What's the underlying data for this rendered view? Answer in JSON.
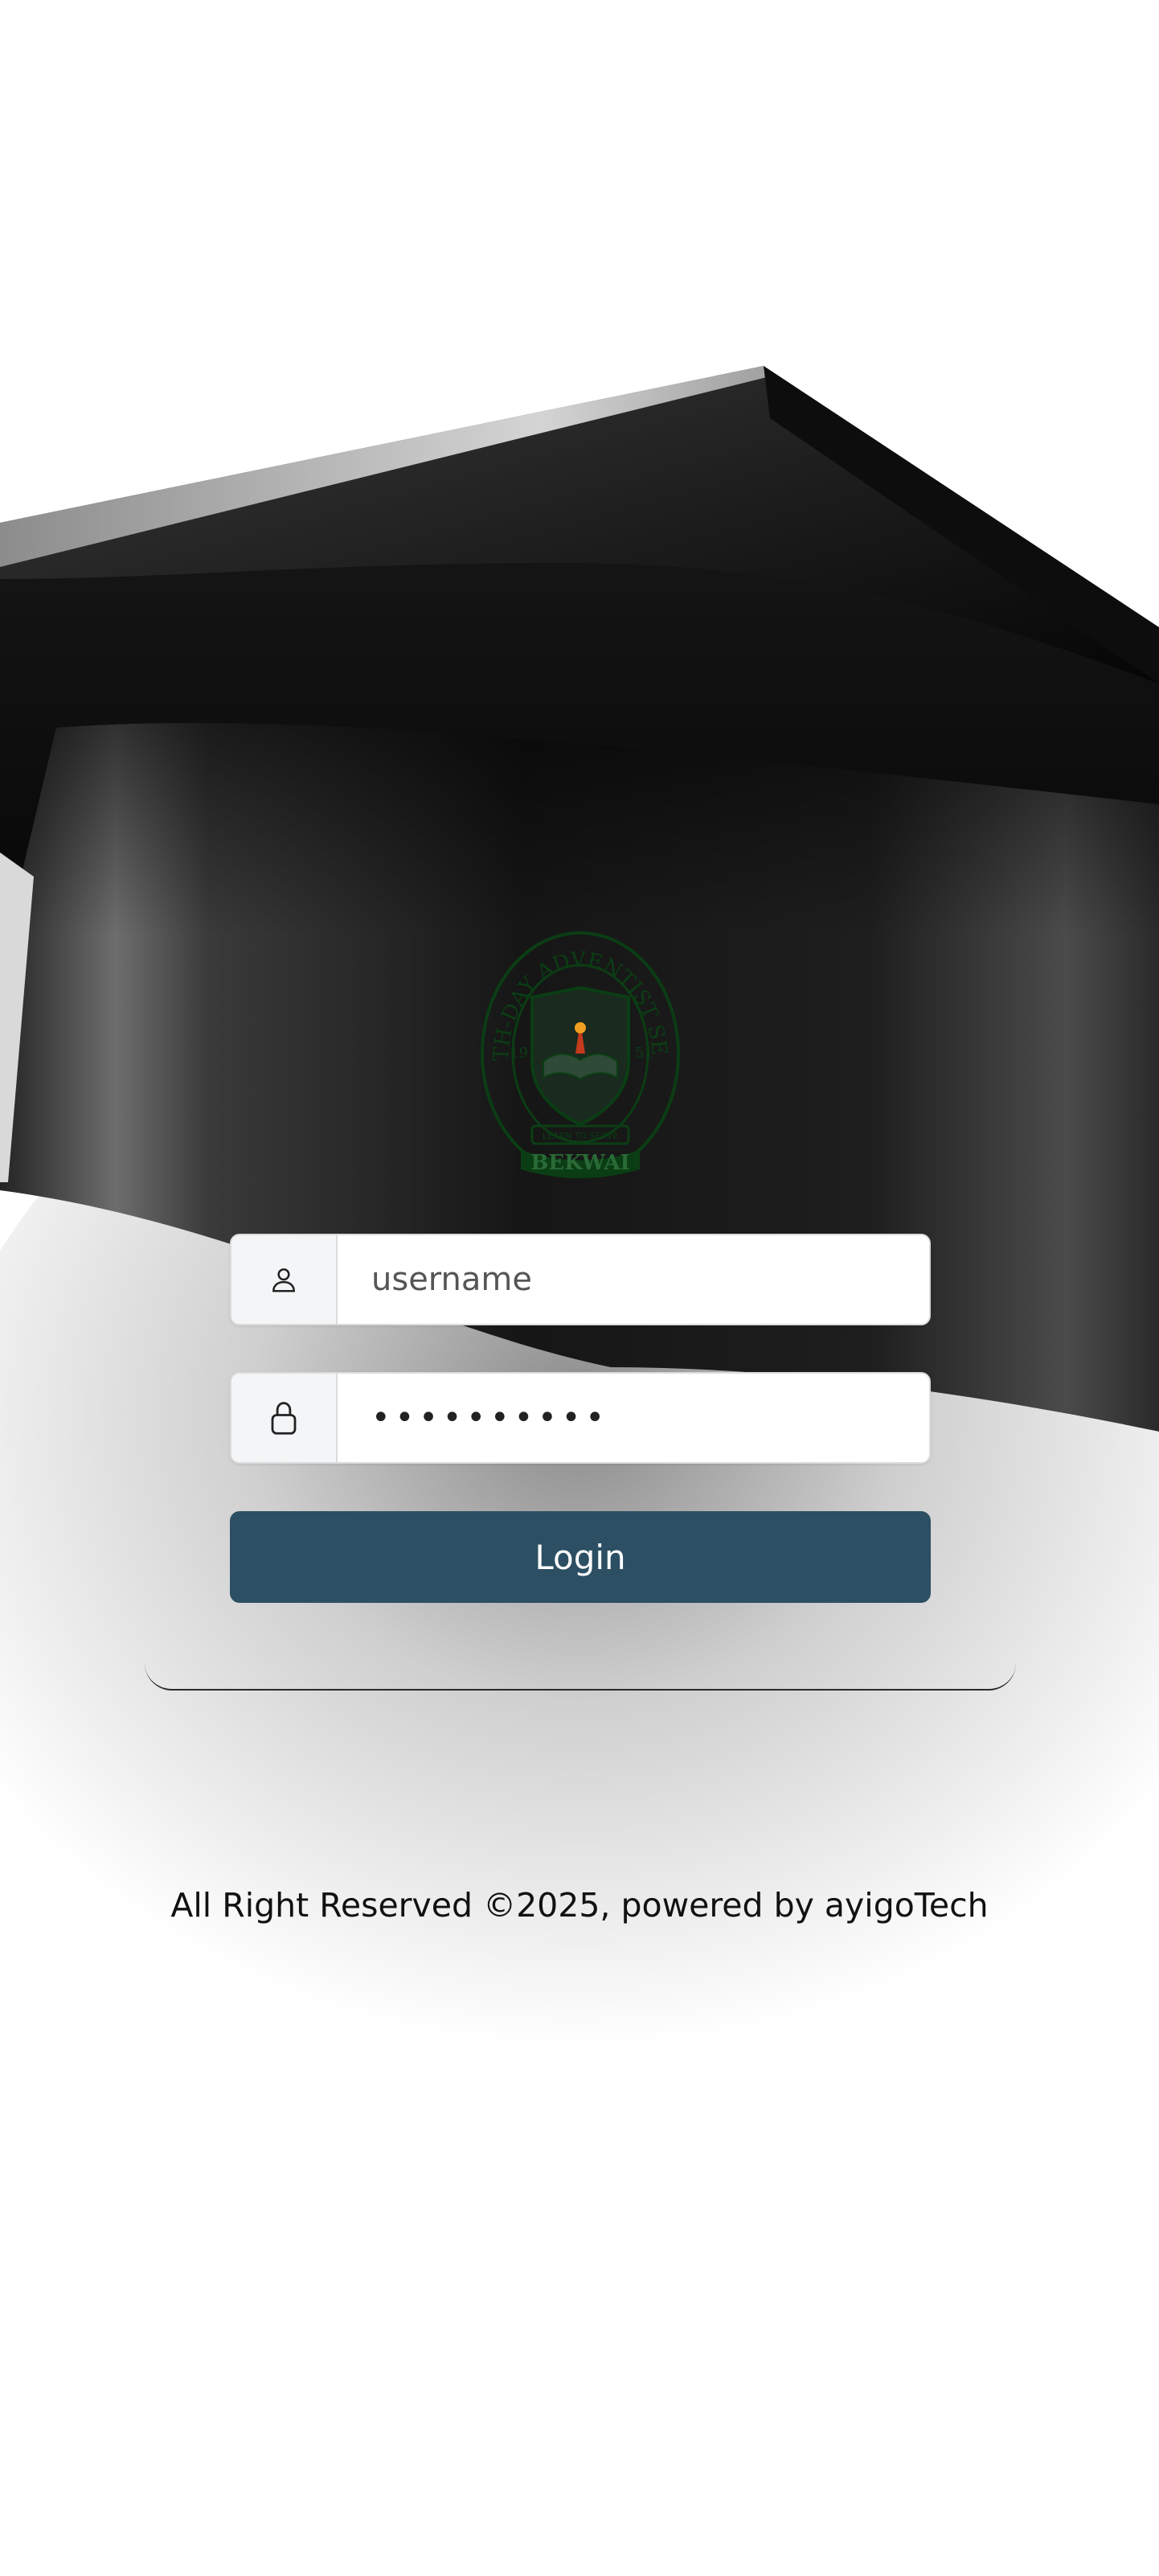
{
  "login": {
    "username_placeholder": "username",
    "password_value": "••••••••••",
    "submit_label": "Login"
  },
  "icons": {
    "username": "user-icon",
    "password": "lock-icon"
  },
  "crest": {
    "arc_top": "SEVENTH-DAY ADVENTIST SEC. SCH.",
    "arc_bottom": "BEKWAI",
    "year_left": "19",
    "year_right": "51",
    "ribbon": "LEARN TO SERVE"
  },
  "footer": {
    "text": "All Right Reserved ©2025, powered by ayigoTech"
  },
  "colors": {
    "button": "#2c4f63",
    "crest": "#0b3d14"
  }
}
